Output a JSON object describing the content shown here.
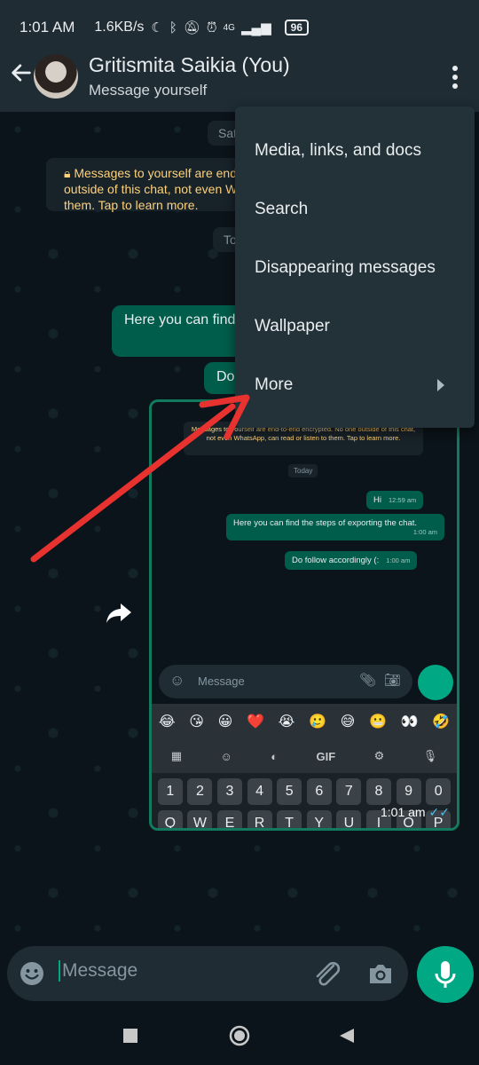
{
  "status_bar": {
    "time": "1:01 AM",
    "speed": "1.6KB/s",
    "signal_label": "4G",
    "battery": "96"
  },
  "header": {
    "name": "Gritismita Saikia (You)",
    "subtitle": "Message yourself"
  },
  "chat": {
    "date_pill": "Sat",
    "notice": "Messages to yourself are end-to-end encrypted. No one outside of this chat, not even WhatsApp, can read or listen to them. Tap to learn more.",
    "today_pill": "To",
    "bubble1": "Here you can find",
    "bubble2": "Do"
  },
  "screenshot_preview": {
    "notice": "Messages to yourself are end-to-end encrypted. No one outside of this chat, not even WhatsApp, can read or listen to them. Tap to learn more.",
    "today": "Today",
    "messages": [
      {
        "text": "Hi",
        "time": "12:59 am"
      },
      {
        "text": "Here you can find the steps of exporting the chat.",
        "time": "1:00 am"
      },
      {
        "text": "Do follow accordingly (:",
        "time": "1:00 am"
      }
    ],
    "input_placeholder": "Message",
    "emojis": [
      "😂",
      "😘",
      "😀",
      "❤️",
      "😭",
      "🥲",
      "😅",
      "😬",
      "👀",
      "🤣"
    ],
    "tools": [
      "GIF"
    ],
    "keys": [
      "1",
      "2",
      "3",
      "4",
      "5",
      "6",
      "7",
      "8",
      "9",
      "0"
    ],
    "keys_row2": [
      "Q",
      "W",
      "E",
      "R",
      "T",
      "Y",
      "U",
      "I",
      "O",
      "P"
    ],
    "time": "1:01 am"
  },
  "menu": {
    "items": [
      {
        "label": "Media, links, and docs"
      },
      {
        "label": "Search"
      },
      {
        "label": "Disappearing messages"
      },
      {
        "label": "Wallpaper"
      },
      {
        "label": "More"
      }
    ]
  },
  "composer": {
    "placeholder": "Message"
  },
  "colors": {
    "accent": "#00a884",
    "bubble": "#005c4b",
    "annotation_arrow": "#e8322f"
  }
}
